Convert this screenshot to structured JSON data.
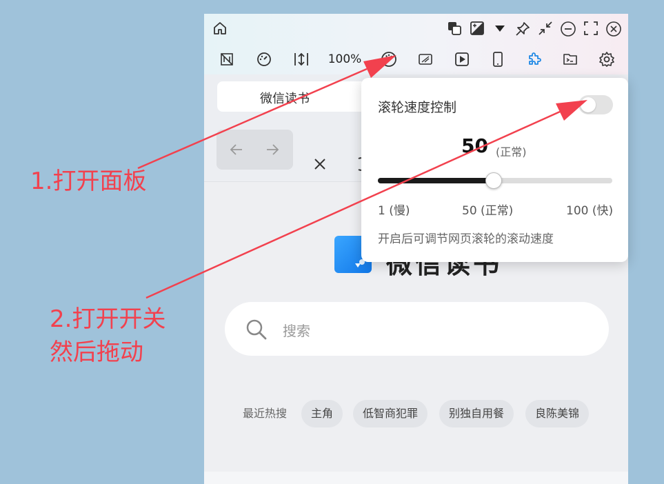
{
  "toolbar": {
    "zoom_label": "100%"
  },
  "tab": {
    "title": "微信读书",
    "close_glyph": "×"
  },
  "brand": {
    "name": "微信读书"
  },
  "search": {
    "placeholder": "搜索"
  },
  "hot": {
    "label": "最近热搜",
    "items": [
      "主角",
      "低智商犯罪",
      "别独自用餐",
      "良陈美锦"
    ]
  },
  "popover": {
    "title": "滚轮速度控制",
    "toggle_on": false,
    "value": "50",
    "value_note": "(正常)",
    "slider": {
      "min": 1,
      "max": 100,
      "value": 50
    },
    "ticks": [
      "1 (慢)",
      "50 (正常)",
      "100 (快)"
    ],
    "description": "开启后可调节网页滚轮的滚动速度"
  },
  "annotations": {
    "step1": "1.打开面板",
    "step2_line1": "2.打开开关",
    "step2_line2": "然后拖动"
  },
  "colors": {
    "accent": "#f2414e",
    "extension_icon": "#1e88e5",
    "background": "#9fc2da"
  }
}
